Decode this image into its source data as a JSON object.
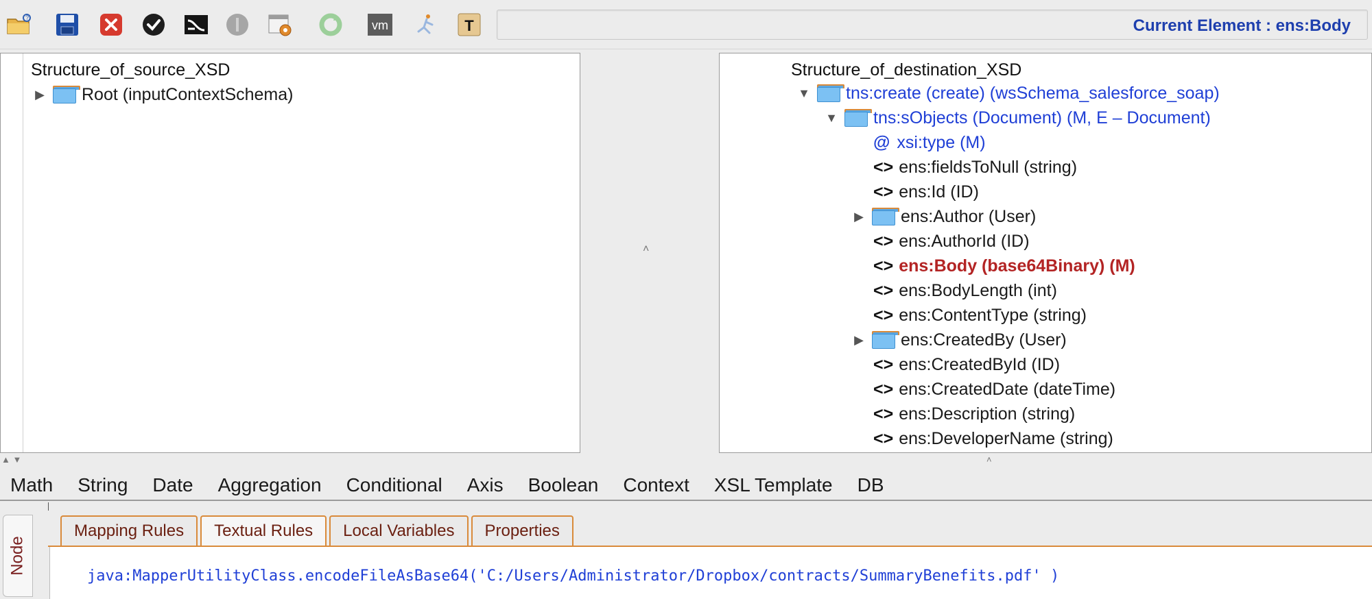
{
  "toolbar": {
    "buttons": [
      {
        "name": "open-folder-icon"
      },
      {
        "name": "save-icon"
      },
      {
        "name": "close-icon"
      },
      {
        "name": "check-icon"
      },
      {
        "name": "mapping-icon"
      },
      {
        "name": "stop-icon"
      },
      {
        "name": "settings-icon"
      },
      {
        "name": "refresh-icon"
      },
      {
        "name": "vm-icon"
      },
      {
        "name": "run-icon"
      },
      {
        "name": "text-icon"
      }
    ],
    "vm_label": "vm",
    "t_label": "T",
    "current_element": "Current Element : ens:Body"
  },
  "source_tree": {
    "header": "Structure_of_source_XSD",
    "root_label": "Root (inputContextSchema)"
  },
  "destination_tree": {
    "header": "Structure_of_destination_XSD",
    "rows": [
      {
        "kind": "folder",
        "expanded": true,
        "text": "tns:create  (create) (wsSchema_salesforce_soap)",
        "color": "blue"
      },
      {
        "kind": "folder",
        "expanded": true,
        "text": "tns:sObjects  (Document)  (M, E – Document)",
        "color": "blue"
      },
      {
        "kind": "attribute",
        "marker": "@",
        "text": "xsi:type  (M)",
        "color": "blue"
      },
      {
        "kind": "element",
        "marker": "<>",
        "text": "ens:fieldsToNull  (string)",
        "color": "black"
      },
      {
        "kind": "element",
        "marker": "<>",
        "text": "ens:Id  (ID)",
        "color": "black"
      },
      {
        "kind": "folder",
        "expanded": false,
        "text": "ens:Author  (User)",
        "color": "black"
      },
      {
        "kind": "element",
        "marker": "<>",
        "text": "ens:AuthorId  (ID)",
        "color": "black"
      },
      {
        "kind": "element",
        "marker": "<>",
        "text": "ens:Body  (base64Binary)  (M)",
        "color": "red"
      },
      {
        "kind": "element",
        "marker": "<>",
        "text": "ens:BodyLength  (int)",
        "color": "black"
      },
      {
        "kind": "element",
        "marker": "<>",
        "text": "ens:ContentType  (string)",
        "color": "black"
      },
      {
        "kind": "folder",
        "expanded": false,
        "text": "ens:CreatedBy  (User)",
        "color": "black"
      },
      {
        "kind": "element",
        "marker": "<>",
        "text": "ens:CreatedById  (ID)",
        "color": "black"
      },
      {
        "kind": "element",
        "marker": "<>",
        "text": "ens:CreatedDate  (dateTime)",
        "color": "black"
      },
      {
        "kind": "element",
        "marker": "<>",
        "text": "ens:Description  (string)",
        "color": "black"
      },
      {
        "kind": "element",
        "marker": "<>",
        "text": "ens:DeveloperName  (string)",
        "color": "black"
      }
    ]
  },
  "function_menu": [
    "Math",
    "String",
    "Date",
    "Aggregation",
    "Conditional",
    "Axis",
    "Boolean",
    "Context",
    "XSL Template",
    "DB"
  ],
  "side_tab": "Node",
  "tabs": [
    {
      "label": "Mapping Rules",
      "active": false
    },
    {
      "label": "Textual Rules",
      "active": true
    },
    {
      "label": "Local Variables",
      "active": false
    },
    {
      "label": "Properties",
      "active": false
    }
  ],
  "code": "java:MapperUtilityClass.encodeFileAsBase64('C:/Users/Administrator/Dropbox/contracts/SummaryBenefits.pdf' )",
  "colors": {
    "blue": "#1f3fd6",
    "red": "#b32424",
    "accent_tab": "#d98a3a"
  }
}
